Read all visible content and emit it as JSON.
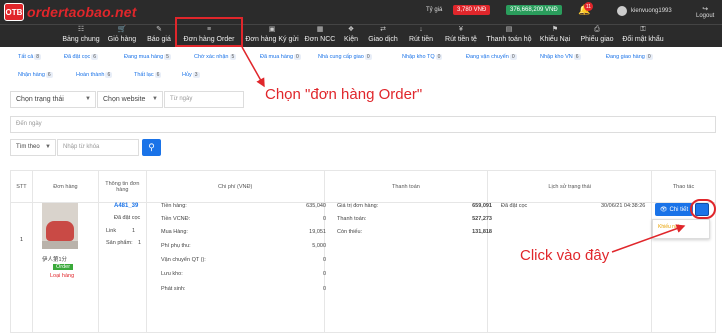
{
  "brand": {
    "logo_badge": "OTB",
    "logo_text": "ordertaobao.net"
  },
  "header": {
    "rate_label": "Tỷ giá",
    "rate_value": "3,780 VNĐ",
    "balance_value": "376,668,209 VNĐ",
    "notif_count": "11",
    "username": "kienvuong1993",
    "logout_label": "Logout"
  },
  "nav": [
    {
      "label": "Bảng chung",
      "icon": "dashboard-icon"
    },
    {
      "label": "Giỏ hàng",
      "icon": "cart-icon"
    },
    {
      "label": "Báo giá",
      "icon": "quote-icon"
    },
    {
      "label": "Đơn hàng Order",
      "icon": "list-icon"
    },
    {
      "label": "Đơn hàng Ký gửi",
      "icon": "box-icon"
    },
    {
      "label": "Đơn NCC",
      "icon": "supplier-icon"
    },
    {
      "label": "Kiện",
      "icon": "package-icon"
    },
    {
      "label": "Giao dịch",
      "icon": "transaction-icon"
    },
    {
      "label": "Rút tiền",
      "icon": "withdraw-icon"
    },
    {
      "label": "Rút tiền tệ",
      "icon": "currency-icon"
    },
    {
      "label": "Thanh toán hộ",
      "icon": "payment-icon"
    },
    {
      "label": "Khiếu Nại",
      "icon": "complaint-icon"
    },
    {
      "label": "Phiếu giao",
      "icon": "delivery-icon"
    },
    {
      "label": "Đổi mật khẩu",
      "icon": "key-icon"
    }
  ],
  "status_tabs_row1": [
    {
      "label": "Tất cả",
      "count": "8"
    },
    {
      "label": "Đã đặt cọc",
      "count": "6"
    },
    {
      "label": "Đang mua hàng",
      "count": "5"
    },
    {
      "label": "Chờ xác nhận",
      "count": "5"
    },
    {
      "label": "Đã mua hàng",
      "count": "0"
    },
    {
      "label": "Nhà cung cấp giao",
      "count": "0"
    },
    {
      "label": "Nhập kho TQ",
      "count": "0"
    },
    {
      "label": "Đang vận chuyển",
      "count": "0"
    },
    {
      "label": "Nhập kho VN",
      "count": "6"
    },
    {
      "label": "Đang giao hàng",
      "count": "0"
    }
  ],
  "status_tabs_row2": [
    {
      "label": "Nhận hàng",
      "count": "6"
    },
    {
      "label": "Hoàn thành",
      "count": "6"
    },
    {
      "label": "Thất lạc",
      "count": "6"
    },
    {
      "label": "Hủy",
      "count": "3"
    }
  ],
  "filters": {
    "status_placeholder": "Chọn trạng thái",
    "website_placeholder": "Chọn website",
    "from_date_placeholder": "Từ ngày",
    "to_date_placeholder": "Đến ngày",
    "search_by": "Tìm theo",
    "keyword_placeholder": "Nhập từ khóa"
  },
  "table": {
    "headers": [
      "STT",
      "Đơn hàng",
      "Thông tin đơn hàng",
      "Chi phí (VNĐ)",
      "Thanh toán",
      "Lịch sử trạng thái",
      "Thao tác"
    ],
    "row": {
      "stt": "1",
      "shop": "伊人第1分",
      "type_badge": "Order",
      "type_link": "Loại hàng",
      "order_code": "A481_39",
      "order_status": "Đã đặt cọc",
      "link_label": "Link",
      "link_count": "1",
      "products_label": "Sản phẩm:",
      "products_count": "1",
      "costs": [
        {
          "label": "Tiền hàng:",
          "value": "635,040"
        },
        {
          "label": "Tiền VCNĐ:",
          "value": "0"
        },
        {
          "label": "Mua Hàng:",
          "value": "19,051"
        },
        {
          "label": "Phí phụ thu:",
          "value": "5,000"
        },
        {
          "label": "Vận chuyển QT ():",
          "value": "0"
        },
        {
          "label": "Lưu kho:",
          "value": "0"
        },
        {
          "label": "Phát sinh:",
          "value": "0"
        }
      ],
      "payments": [
        {
          "label": "Giá trị đơn hàng:",
          "value": "659,091"
        },
        {
          "label": "Thanh toán:",
          "value": "527,273"
        },
        {
          "label": "Còn thiếu:",
          "value": "131,818"
        }
      ],
      "history_status": "Đã đặt cọc",
      "history_time": "30/06/21 04:38:26",
      "detail_button": "Chi tiết",
      "dropdown_item": "Khiếu nại"
    }
  },
  "annotations": {
    "choose_order": "Chọn \"đơn hàng Order\"",
    "click_here": "Click vào đây"
  }
}
